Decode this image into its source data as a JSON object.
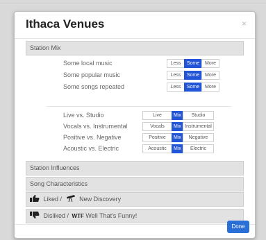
{
  "modal": {
    "title": "Ithaca Venues",
    "close_glyph": "×",
    "done_label": "Done"
  },
  "sections": {
    "station_mix": "Station Mix",
    "station_influences": "Station Influences",
    "song_characteristics": "Song Characteristics",
    "liked_label": "Liked /",
    "liked_extra": "New Discovery",
    "disliked_label": "Disliked /",
    "disliked_wtf": "WTF",
    "disliked_extra": "Well That's Funny!"
  },
  "mix": {
    "level_rows": [
      {
        "label": "Some local music",
        "options": [
          "Less",
          "Some",
          "More"
        ],
        "selected": "Some"
      },
      {
        "label": "Some popular music",
        "options": [
          "Less",
          "Some",
          "More"
        ],
        "selected": "Some"
      },
      {
        "label": "Some songs repeated",
        "options": [
          "Less",
          "Some",
          "More"
        ],
        "selected": "Some"
      }
    ],
    "balance_rows": [
      {
        "label": "Live vs. Studio",
        "options": [
          "Live",
          "Mix",
          "Studio"
        ],
        "selected": "Mix"
      },
      {
        "label": "Vocals vs. Instrumental",
        "options": [
          "Vocals",
          "Mix",
          "Instrumental"
        ],
        "selected": "Mix"
      },
      {
        "label": "Positive vs. Negative",
        "options": [
          "Positive",
          "Mix",
          "Negative"
        ],
        "selected": "Mix"
      },
      {
        "label": "Acoustic vs. Electric",
        "options": [
          "Acoustic",
          "Mix",
          "Electric"
        ],
        "selected": "Mix"
      }
    ]
  },
  "colors": {
    "accent": "#2154d6",
    "done_button": "#2a6fd6",
    "section_bg": "#e2e2e2"
  },
  "icons": {
    "liked": "thumbs-up-icon",
    "discovery": "telescope-icon",
    "disliked": "thumbs-down-icon"
  }
}
